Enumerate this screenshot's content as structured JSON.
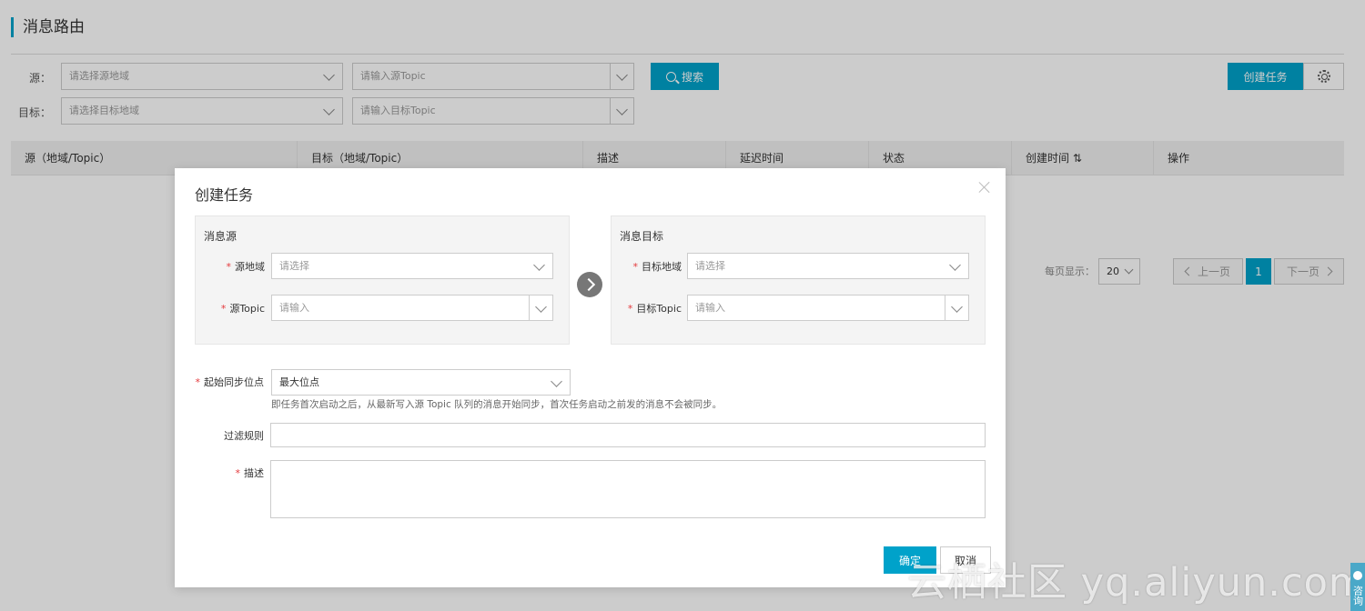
{
  "page": {
    "title": "消息路由"
  },
  "filters": {
    "source_label": "源：",
    "target_label": "目标：",
    "source_region_placeholder": "请选择源地域",
    "source_topic_placeholder": "请输入源Topic",
    "target_region_placeholder": "请选择目标地域",
    "target_topic_placeholder": "请输入目标Topic",
    "search_label": "搜索"
  },
  "toolbar": {
    "create_task_label": "创建任务"
  },
  "table": {
    "columns": [
      "源（地域/Topic）",
      "目标（地域/Topic）",
      "描述",
      "延迟时间",
      "状态",
      "创建时间 ⇅",
      "操作"
    ]
  },
  "pagination": {
    "page_size_label": "每页显示：",
    "page_size": "20",
    "prev_label": "上一页",
    "current_page": "1",
    "next_label": "下一页"
  },
  "modal": {
    "title": "创建任务",
    "source_panel": {
      "title": "消息源",
      "region_label": "源地域",
      "region_placeholder": "请选择",
      "topic_label": "源Topic",
      "topic_placeholder": "请输入"
    },
    "target_panel": {
      "title": "消息目标",
      "region_label": "目标地域",
      "region_placeholder": "请选择",
      "topic_label": "目标Topic",
      "topic_placeholder": "请输入"
    },
    "sync_start_label": "起始同步位点",
    "sync_start_value": "最大位点",
    "sync_start_help": "即任务首次启动之后，从最新写入源 Topic 队列的消息开始同步，首次任务启动之前发的消息不会被同步。",
    "filter_rule_label": "过滤规则",
    "description_label": "描述",
    "confirm_label": "确定",
    "cancel_label": "取消"
  },
  "watermark": "云栖社区 yq.aliyun.com",
  "side_tab": "咨询",
  "colors": {
    "accent": "#00a2ca",
    "required": "#e4393c"
  },
  "icons": [
    "search-icon",
    "gear-icon",
    "chevron-down-icon",
    "chevron-left-icon",
    "chevron-right-icon",
    "arrow-right-circle-icon",
    "close-icon"
  ]
}
